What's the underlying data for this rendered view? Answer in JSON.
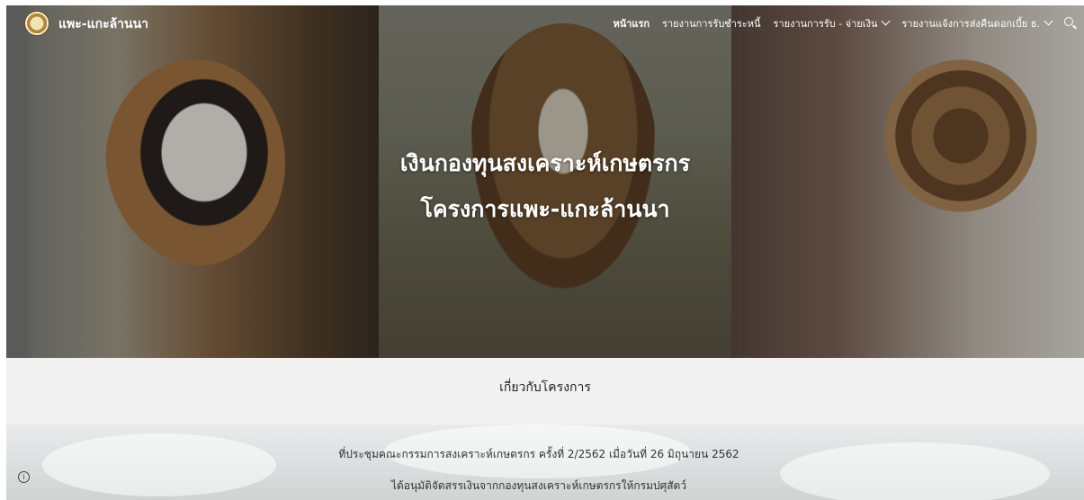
{
  "site": {
    "title": "แพะ-แกะล้านนา"
  },
  "nav": {
    "items": [
      {
        "label": "หน้าแรก",
        "active": true,
        "dropdown": false
      },
      {
        "label": "รายงานการรับชำระหนี้",
        "active": false,
        "dropdown": false
      },
      {
        "label": "รายงานการรับ - จ่ายเงิน",
        "active": false,
        "dropdown": true
      },
      {
        "label": "รายงานแจ้งการส่งคืนดอกเบี้ย ธ.",
        "active": false,
        "dropdown": true
      }
    ],
    "search_icon": "search-icon"
  },
  "hero": {
    "line1": "เงินกองทุนสงเคราะห์เกษตรกร",
    "line2": "โครงการแพะ-แกะล้านนา"
  },
  "about": {
    "title": "เกี่ยวกับโครงการ",
    "line1": "ที่ประชุมคณะกรรมการสงเคราะห์เกษตรกร ครั้งที่ 2/2562 เมื่อวันที่ 26 มิถุนายน 2562",
    "line2": "ได้อนุมัติจัดสรรเงินจากกองทุนสงเคราะห์เกษตรกรให้กรมปศุสัตว์"
  },
  "colors": {
    "nav_text": "#ffffff",
    "about_bg": "#f1f1f1",
    "body_text": "#333333"
  }
}
